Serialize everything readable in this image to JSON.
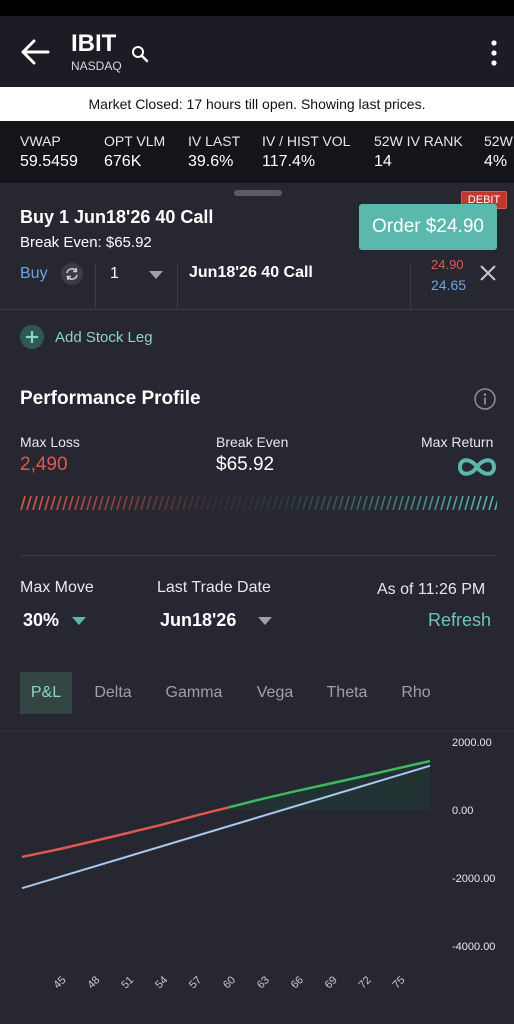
{
  "header": {
    "ticker": "IBIT",
    "exchange": "NASDAQ",
    "icons": [
      "back-arrow-icon",
      "search-icon",
      "more-vert-icon"
    ]
  },
  "banner": "Market Closed: 17 hours till open. Showing last prices.",
  "stats": [
    {
      "label": "VWAP",
      "value": "59.5459"
    },
    {
      "label": "OPT VLM",
      "value": "676K"
    },
    {
      "label": "IV LAST",
      "value": "39.6%"
    },
    {
      "label": "IV / HIST VOL",
      "value": "117.4%"
    },
    {
      "label": "52W IV RANK",
      "value": "14"
    },
    {
      "label": "52W",
      "value": "4%"
    }
  ],
  "order": {
    "title": "Buy 1 Jun18'26 40 Call",
    "break_even": "Break Even: $65.92",
    "badge": "DEBIT",
    "button": "Order $24.90"
  },
  "leg": {
    "side": "Buy",
    "qty": "1",
    "desc": "Jun18'26 40 Call",
    "ask": "24.90",
    "bid": "24.65"
  },
  "add_stock_leg": "Add Stock Leg",
  "performance": {
    "title": "Performance Profile",
    "max_loss_label": "Max Loss",
    "max_loss": "2,490",
    "break_even_label": "Break Even",
    "break_even": "$65.92",
    "max_return_label": "Max Return",
    "max_return_icon": "infinity-icon"
  },
  "controls": {
    "max_move_label": "Max Move",
    "max_move": "30%",
    "last_trade_label": "Last Trade Date",
    "last_trade": "Jun18'26",
    "as_of": "As of 11:26 PM",
    "refresh": "Refresh"
  },
  "tabs": [
    "P&L",
    "Delta",
    "Gamma",
    "Vega",
    "Theta",
    "Rho"
  ],
  "active_tab": "P&L",
  "colors": {
    "accent": "#5ab8ad",
    "loss": "#e0594f",
    "profit": "#3dba5f",
    "blue": "#6aa6e3",
    "line_today": "#a9c8f0"
  },
  "chart_data": {
    "type": "line",
    "x_ticks": [
      "45",
      "48",
      "51",
      "54",
      "57",
      "60",
      "63",
      "66",
      "69",
      "72",
      "75"
    ],
    "y_ticks": [
      "2000.00",
      "0.00",
      "-2000.00",
      "-4000.00"
    ],
    "ylim": [
      -4000,
      2000
    ],
    "xlim": [
      41.7,
      77.8
    ],
    "series": [
      {
        "x": [
          41.7,
          45,
          48,
          51,
          54,
          57,
          60,
          63,
          66,
          69,
          72,
          75,
          77.8
        ],
        "y": [
          -1380,
          -1150,
          -920,
          -680,
          -440,
          -170,
          80,
          330,
          560,
          780,
          1000,
          1230,
          1440
        ]
      },
      {
        "x": [
          41.7,
          77.8
        ],
        "y": [
          -2300,
          1300
        ]
      }
    ],
    "break_even_x": 60
  }
}
